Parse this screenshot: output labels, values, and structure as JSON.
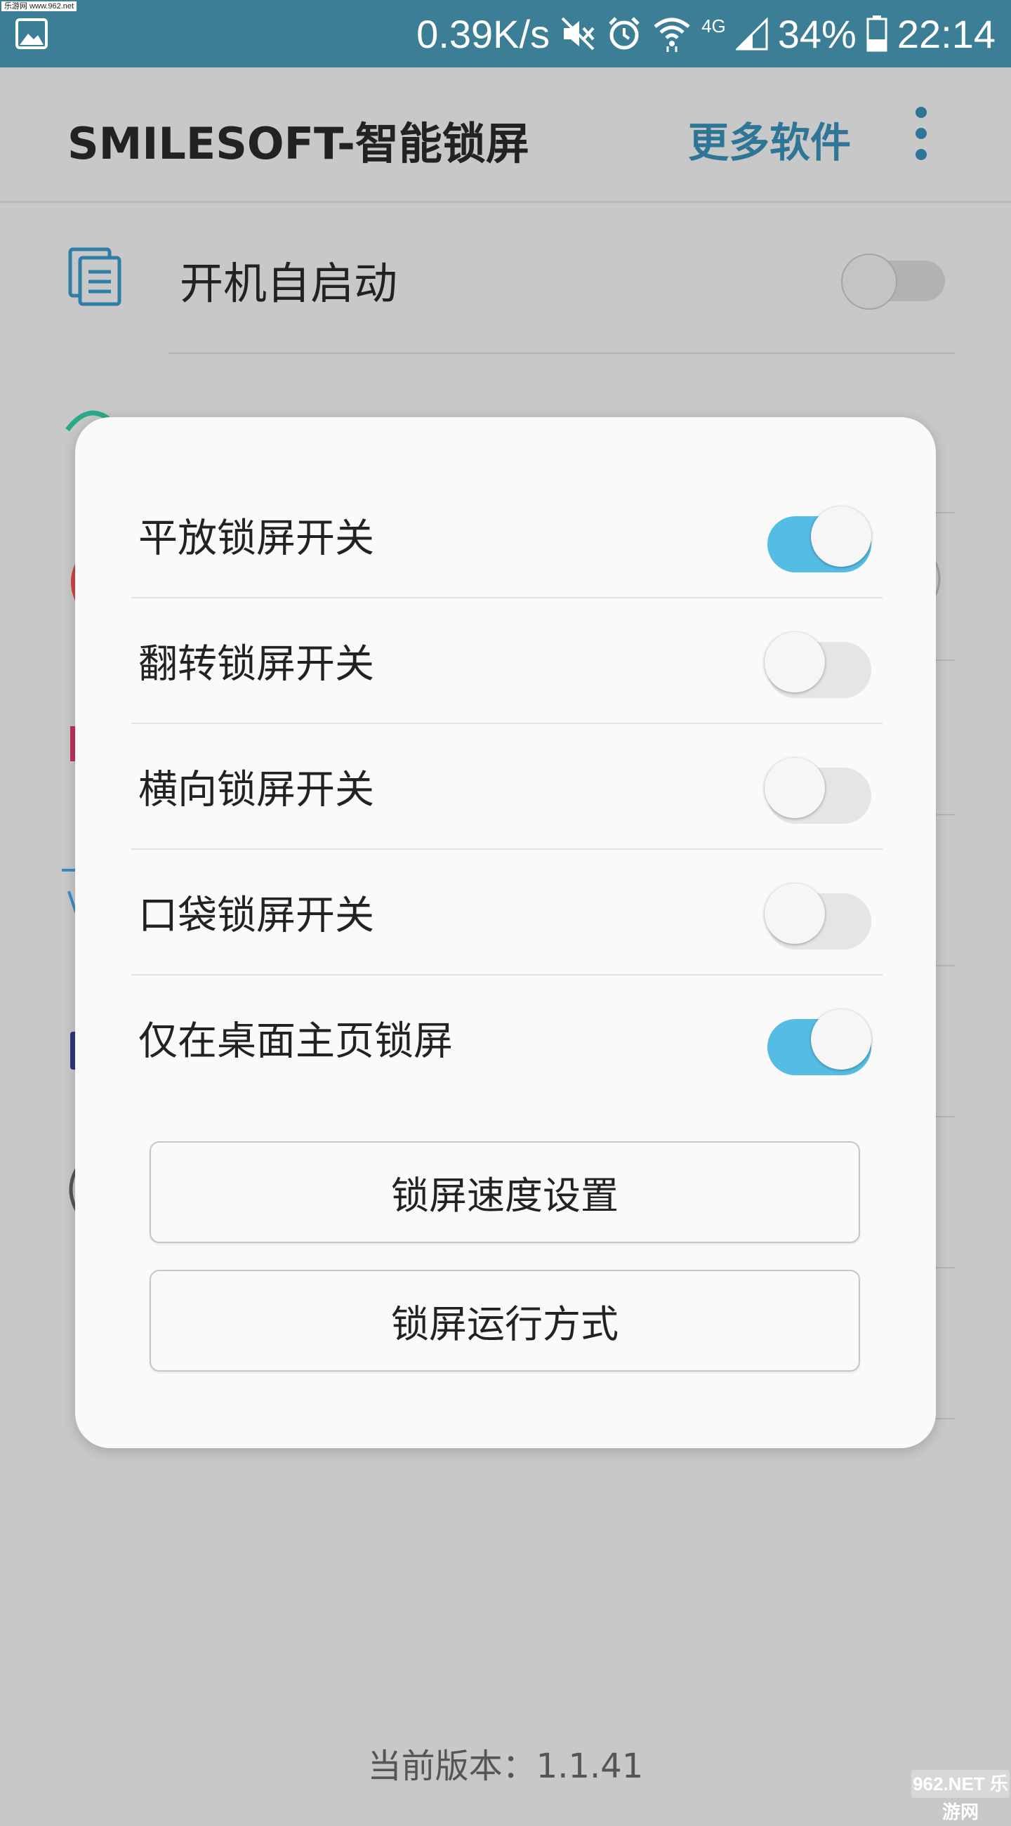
{
  "status_bar": {
    "watermark_tag": "乐游网 www.962.net",
    "net_speed": "0.39K/s",
    "network_type": "4G",
    "battery": "34%",
    "time": "22:14",
    "icons": [
      "gallery-icon",
      "mute-icon",
      "alarm-icon",
      "wifi-icon",
      "signal-icon",
      "battery-icon"
    ]
  },
  "toolbar": {
    "title": "SMILESOFT-智能锁屏",
    "more_software": "更多软件"
  },
  "background_list": {
    "rows": [
      {
        "label": "开机自启动",
        "icon": "document-icon",
        "enabled": false
      }
    ]
  },
  "dialog": {
    "toggles": [
      {
        "label": "平放锁屏开关",
        "enabled": true
      },
      {
        "label": "翻转锁屏开关",
        "enabled": false
      },
      {
        "label": "横向锁屏开关",
        "enabled": false
      },
      {
        "label": "口袋锁屏开关",
        "enabled": false
      },
      {
        "label": "仅在桌面主页锁屏",
        "enabled": true
      }
    ],
    "buttons": {
      "speed_settings": "锁屏速度设置",
      "run_mode": "锁屏运行方式"
    }
  },
  "footer": {
    "version": "当前版本：1.1.41",
    "watermark": "962.NET 乐游网"
  },
  "colors": {
    "status_bar": "#3c7e96",
    "accent": "#2f7696",
    "switch_on": "#55bde4",
    "overlay": "#c8c8c8"
  }
}
